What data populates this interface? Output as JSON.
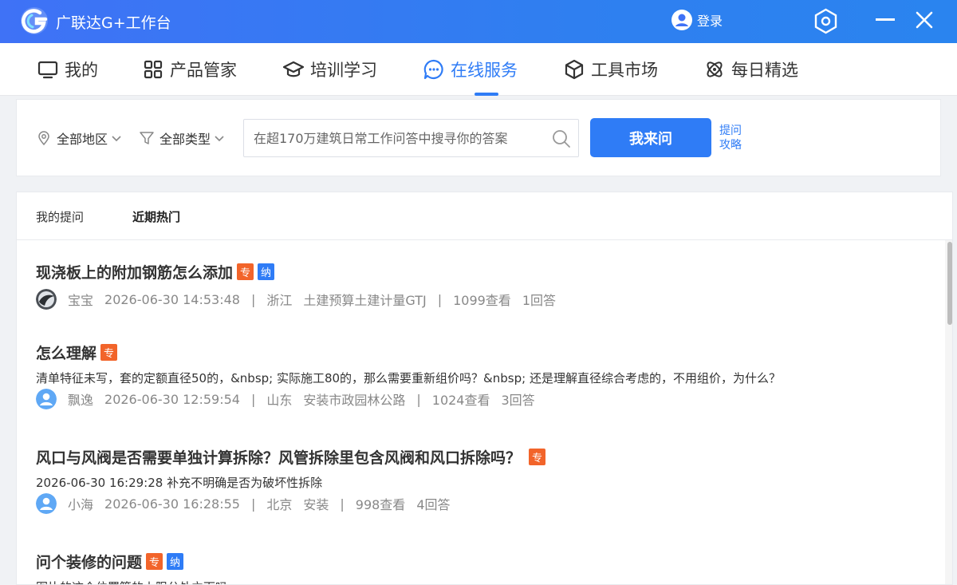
{
  "app": {
    "title": "广联达G+工作台",
    "login_label": "登录"
  },
  "nav": {
    "tabs": [
      {
        "label": "我的",
        "icon": "monitor-icon"
      },
      {
        "label": "产品管家",
        "icon": "grid-icon"
      },
      {
        "label": "培训学习",
        "icon": "graduation-cap-icon"
      },
      {
        "label": "在线服务",
        "icon": "chat-bubble-icon",
        "active": true
      },
      {
        "label": "工具市场",
        "icon": "cube-icon"
      },
      {
        "label": "每日精选",
        "icon": "atom-icon"
      }
    ]
  },
  "search": {
    "region_filter": "全部地区",
    "type_filter": "全部类型",
    "placeholder": "在超170万建筑日常工作问答中搜寻你的答案",
    "ask_button": "我来问",
    "guide_line1": "提问",
    "guide_line2": "攻略"
  },
  "list": {
    "subtabs": [
      "我的提问",
      "近期热门"
    ],
    "active_subtab": "近期热门",
    "badge_zhuan": "专",
    "badge_na": "纳",
    "items": [
      {
        "title": "现浇板上的附加钢筋怎么添加",
        "badges": [
          "专",
          "纳"
        ],
        "user": "宝宝",
        "time": "2026-06-30 14:53:48",
        "region": "浙江",
        "category": "土建预算土建计量GTJ",
        "views": "1099查看",
        "answers": "1回答"
      },
      {
        "title": "怎么理解",
        "badges": [
          "专"
        ],
        "desc": "清单特征未写，套的定额直径50的，&nbsp; 实际施工80的，那么需要重新组价吗？&nbsp; 还是理解直径综合考虑的，不用组价，为什么？",
        "user": "飘逸",
        "time": "2026-06-30 12:59:54",
        "region": "山东",
        "category": "安装市政园林公路",
        "views": "1024查看",
        "answers": "3回答"
      },
      {
        "title": "风口与风阀是否需要单独计算拆除？风管拆除里包含风阀和风口拆除吗？",
        "badges": [
          "专"
        ],
        "desc": "2026-06-30 16:29:28 补充不明确是否为破坏性拆除",
        "user": "小海",
        "time": "2026-06-30 16:28:55",
        "region": "北京",
        "category": "安装",
        "views": "998查看",
        "answers": "4回答"
      },
      {
        "title": "问个装修的问题",
        "badges": [
          "专",
          "纳"
        ],
        "desc": "图片的这个位置算的上限分处立面吗"
      }
    ]
  },
  "colors": {
    "brand_blue": "#2f7cf6",
    "badge_orange": "#f2642a",
    "titlebar_blue": "#3f72f6"
  }
}
